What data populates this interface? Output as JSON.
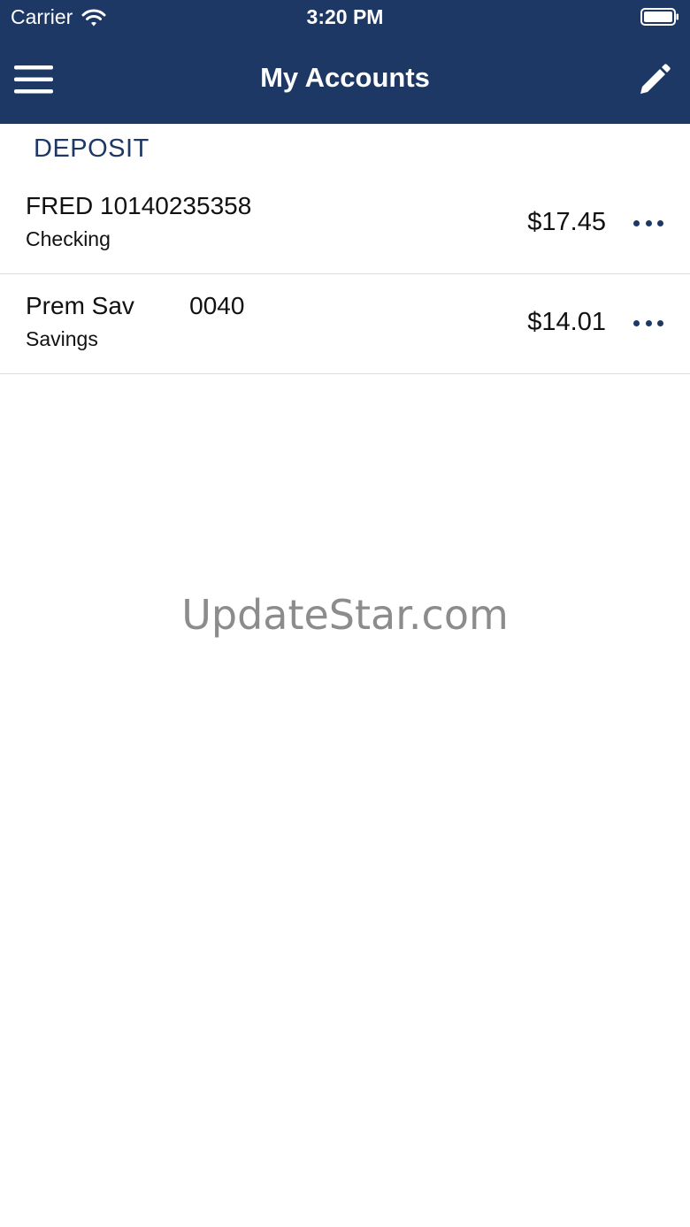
{
  "status_bar": {
    "carrier": "Carrier",
    "time": "3:20 PM"
  },
  "nav": {
    "title": "My Accounts",
    "menu_icon": "hamburger-menu-icon",
    "edit_icon": "pencil-icon"
  },
  "colors": {
    "header_bg": "#1d3864",
    "accent": "#1d3864",
    "divider": "#dcdcdc"
  },
  "section": {
    "title": "DEPOSIT"
  },
  "accounts": [
    {
      "name": "FRED 10140235358",
      "type": "Checking",
      "balance": "$17.45"
    },
    {
      "name": "Prem Sav        0040",
      "type": "Savings",
      "balance": "$14.01"
    }
  ],
  "watermark": "UpdateStar.com"
}
